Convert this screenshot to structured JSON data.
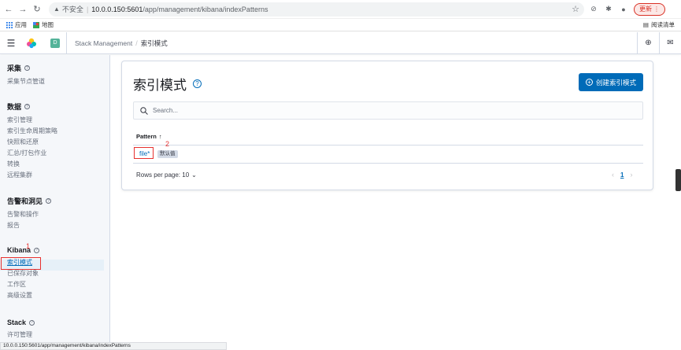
{
  "browser": {
    "url_insecure": "不安全",
    "url_host": "10.0.0.150:5601",
    "url_path": "/app/management/kibana/indexPatterns",
    "update_label": "更新",
    "bookmarks": [
      "应用",
      "地图"
    ],
    "reading_list": "阅读清单",
    "status_url": "10.0.0.150:5601/app/management/kibana/indexPatterns"
  },
  "header": {
    "space_initial": "D",
    "breadcrumb_root": "Stack Management",
    "breadcrumb_current": "索引模式"
  },
  "sidebar": {
    "groups": [
      {
        "title": "采集",
        "items": [
          "采集节点管道"
        ]
      },
      {
        "title": "数据",
        "items": [
          "索引管理",
          "索引生命周期策略",
          "快照和还原",
          "汇总/打包作业",
          "转换",
          "远程集群"
        ]
      },
      {
        "title": "告警和洞见",
        "items": [
          "告警和操作",
          "报告"
        ]
      },
      {
        "title": "Kibana",
        "items": [
          "索引模式",
          "已保存对象",
          "工作区",
          "高级设置"
        ]
      },
      {
        "title": "Stack",
        "items": [
          "许可管理"
        ]
      }
    ]
  },
  "main": {
    "title": "索引模式",
    "create_label": "创建索引模式",
    "search_placeholder": "Search...",
    "column_pattern": "Pattern",
    "rows": [
      {
        "pattern": "file*",
        "badge": "默认值"
      }
    ],
    "rows_per_page": "Rows per page: 10",
    "current_page": "1"
  },
  "annotations": {
    "one": "1",
    "two": "2"
  },
  "colors": {
    "primary": "#006bb8",
    "annotation": "#e7312f",
    "success": "#54b399"
  }
}
